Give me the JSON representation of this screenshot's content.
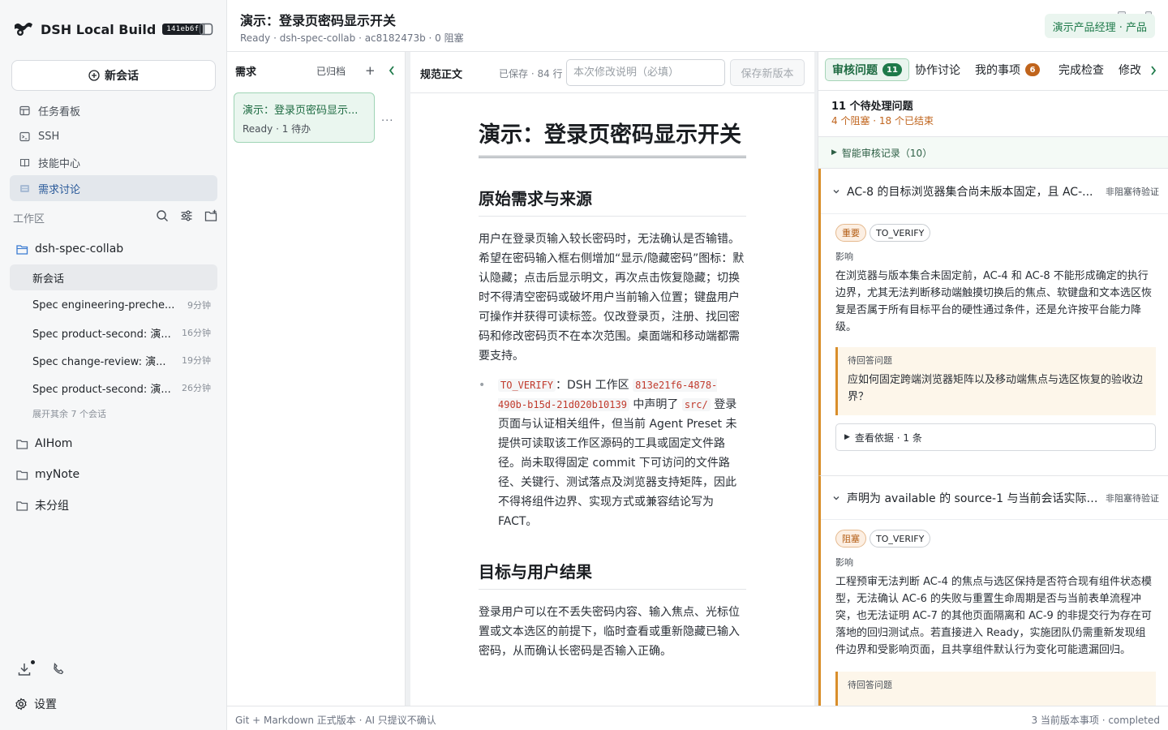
{
  "app": {
    "name": "DSH Local Build",
    "build": "141eb6f"
  },
  "sidebar": {
    "new_chat": "新会话",
    "nav": [
      {
        "label": "任务看板",
        "icon": "table-icon"
      },
      {
        "label": "SSH",
        "icon": "terminal-icon"
      },
      {
        "label": "技能中心",
        "icon": "book-icon"
      },
      {
        "label": "需求讨论",
        "icon": "list-icon"
      }
    ],
    "workspace_label": "工作区",
    "project": "dsh-spec-collab",
    "conversations": [
      {
        "title": "新会话",
        "time": ""
      },
      {
        "title": "Spec engineering-preche...",
        "time": "9分钟"
      },
      {
        "title": "Spec product-second: 演...",
        "time": "16分钟"
      },
      {
        "title": "Spec change-review: 演...",
        "time": "19分钟"
      },
      {
        "title": "Spec product-second: 演...",
        "time": "26分钟"
      }
    ],
    "expand_more": "展开其余 7 个会话",
    "folders": [
      "AIHom",
      "myNote",
      "未分组"
    ],
    "settings": "设置"
  },
  "header": {
    "title": "演示：登录页密码显示开关",
    "subtitle": "Ready · dsh-spec-collab · ac8182473b · 0 阻塞",
    "role": "演示产品经理 · 产品"
  },
  "requirements": {
    "title": "需求",
    "archived": "已归档",
    "add": "+",
    "card_title": "演示：登录页密码显示...",
    "card_status": "Ready · 1 待办",
    "more": "···"
  },
  "spec": {
    "title": "规范正文",
    "saved": "已保存 · 84 行",
    "change_placeholder": "本次修改说明（必填）",
    "save_button": "保存新版本",
    "doc": {
      "h1": "演示：登录页密码显示开关",
      "h2_source": "原始需求与来源",
      "p_source": "用户在登录页输入较长密码时，无法确认是否输错。希望在密码输入框右侧增加“显示/隐藏密码”图标：默认隐藏；点击后显示明文，再次点击恢复隐藏；切换时不得清空密码或破坏用户当前输入位置；键盘用户可操作并获得可读标签。仅改登录页，注册、找回密码和修改密码页不在本次范围。桌面端和移动端都需要支持。",
      "li_tag": "TO_VERIFY",
      "li_a": "：DSH 工作区 ",
      "li_uuid": "813e21f6-4878-490b-b15d-21d020b10139",
      "li_b": " 中声明了 ",
      "li_path": "src/",
      "li_c": " 登录页面与认证相关组件，但当前 Agent Preset 未提供可读取该工作区源码的工具或固定文件路径。尚未取得固定 commit 下可访问的文件路径、关键行、测试落点及浏览器支持矩阵，因此不得将组件边界、实现方式或兼容结论写为 FACT。",
      "h2_goal": "目标与用户结果",
      "p_goal": "登录用户可以在不丢失密码内容、输入焦点、光标位置或文本选区的前提下，临时查看或重新隐藏已输入密码，从而确认长密码是否输入正确。"
    }
  },
  "review": {
    "tabs": [
      {
        "label": "审核问题",
        "count": "11"
      },
      {
        "label": "协作讨论",
        "count": ""
      },
      {
        "label": "我的事项",
        "count": "6"
      },
      {
        "label": "完成检查",
        "count": ""
      },
      {
        "label": "修改",
        "count": ""
      }
    ],
    "summary_title": "11 个待处理问题",
    "summary_sub": "4 个阻塞 · 18 个已结束",
    "audit_log": "智能审核记录（10）",
    "issues": [
      {
        "title": "AC-8 的目标浏览器集合尚未版本固定，且 AC-...",
        "status": "非阻塞待验证",
        "severity": "重要",
        "tag": "TO_VERIFY",
        "impact_label": "影响",
        "impact": "在浏览器与版本集合未固定前，AC-4 和 AC-8 不能形成确定的执行边界，尤其无法判断移动端触摸切换后的焦点、软键盘和文本选区恢复是否属于所有目标平台的硬性通过条件，还是允许按平台能力降级。",
        "question_label": "待回答问题",
        "question": "应如何固定跨端浏览器矩阵以及移动端焦点与选区恢复的验收边界？",
        "evidence": "查看依据 · 1 条"
      },
      {
        "title": "声明为 available 的 source-1 与当前会话实际可...",
        "status": "非阻塞待验证",
        "severity": "阻塞",
        "tag": "TO_VERIFY",
        "impact_label": "影响",
        "impact": "工程预审无法判断 AC-4 的焦点与选区保持是否符合现有组件状态模型，无法确认 AC-6 的失败与重置生命周期是否与当前表单流程冲突，也无法证明 AC-7 的其他页面隔离和 AC-9 的非提交行为存在可落地的回归测试点。若直接进入 Ready，实施团队仍需重新发现组件边界和受影响页面，且共享组件默认行为变化可能遗漏回归。",
        "question_label": "待回答问题"
      }
    ]
  },
  "footer": {
    "left": "Git + Markdown 正式版本 · AI 只提议不确认",
    "right": "3 当前版本事项 · completed"
  }
}
